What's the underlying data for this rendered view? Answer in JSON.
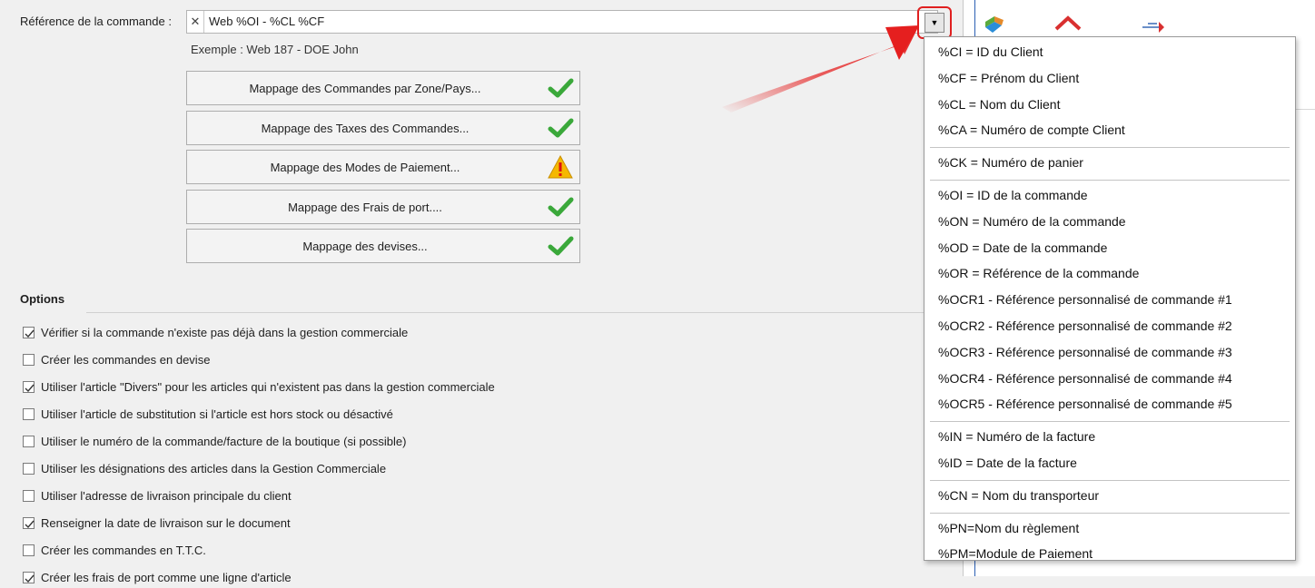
{
  "reference": {
    "label": "Référence de la commande :",
    "value": "Web %OI - %CL %CF",
    "clear_glyph": "✕",
    "dropdown_glyph": "▼",
    "example": "Exemple : Web 187 - DOE John"
  },
  "mapping_buttons": [
    {
      "label": "Mappage des Commandes par Zone/Pays...",
      "status": "ok"
    },
    {
      "label": "Mappage des Taxes des Commandes...",
      "status": "ok"
    },
    {
      "label": "Mappage des Modes de Paiement...",
      "status": "warning"
    },
    {
      "label": "Mappage des Frais de port....",
      "status": "ok"
    },
    {
      "label": "Mappage des devises...",
      "status": "ok"
    }
  ],
  "options": {
    "title": "Options",
    "items": [
      {
        "label": "Vérifier si la commande n'existe pas déjà dans la gestion commerciale",
        "checked": true
      },
      {
        "label": "Créer les commandes en devise",
        "checked": false
      },
      {
        "label": "Utiliser l'article \"Divers\" pour les articles qui n'existent pas dans la gestion commerciale",
        "checked": true
      },
      {
        "label": "Utiliser l'article de substitution si l'article est hors stock ou désactivé",
        "checked": false
      },
      {
        "label": "Utiliser le numéro de la commande/facture de la boutique (si possible)",
        "checked": false
      },
      {
        "label": "Utiliser les désignations des articles dans la Gestion Commerciale",
        "checked": false
      },
      {
        "label": "Utiliser l'adresse de livraison principale du client",
        "checked": false
      },
      {
        "label": "Renseigner la date de livraison sur le document",
        "checked": true
      },
      {
        "label": "Créer les commandes en T.T.C.",
        "checked": false
      },
      {
        "label": "Créer les frais de port comme une ligne d'article",
        "checked": true
      }
    ]
  },
  "menu": {
    "groups": [
      [
        "%CI = ID du Client",
        "%CF = Prénom du Client",
        "%CL = Nom du Client",
        "%CA = Numéro de compte Client"
      ],
      [
        "%CK = Numéro de panier"
      ],
      [
        "%OI = ID de la commande",
        "%ON = Numéro de la commande",
        "%OD = Date de la commande",
        "%OR = Référence de la commande",
        "%OCR1 - Référence personnalisé de commande #1",
        "%OCR2 - Référence personnalisé de commande #2",
        "%OCR3 - Référence personnalisé de commande #3",
        "%OCR4 - Référence personnalisé de commande #4",
        "%OCR5 - Référence personnalisé de commande #5"
      ],
      [
        "%IN = Numéro de la facture",
        "%ID = Date de la facture"
      ],
      [
        "%CN = Nom du transporteur"
      ],
      [
        "%PN=Nom du règlement",
        "%PM=Module de Paiement"
      ]
    ]
  },
  "colors": {
    "ok": "#3aa83a",
    "warning": "#f5b800",
    "arrow": "#e51f1f",
    "panel_accent": "#2b5fb4"
  }
}
